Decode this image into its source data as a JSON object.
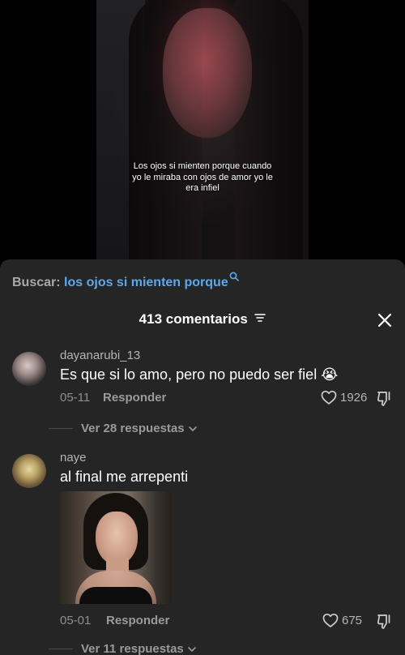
{
  "video": {
    "caption": "Los ojos si mienten porque cuando yo le miraba con ojos de amor yo le era infiel"
  },
  "search": {
    "label": "Buscar:",
    "query": "los ojos si mienten porque"
  },
  "header": {
    "comments_count": "413 comentarios"
  },
  "comments": [
    {
      "username": "dayanarubi_13",
      "text": "Es que si lo amo, pero no puedo ser fiel 😭",
      "date": "05-11",
      "reply_label": "Responder",
      "likes": "1926",
      "view_replies": "Ver 28 respuestas"
    },
    {
      "username": "naye",
      "text": "al final me arrepenti",
      "date": "05-01",
      "reply_label": "Responder",
      "likes": "675",
      "view_replies": "Ver 11 respuestas"
    }
  ],
  "colors": {
    "panel_bg": "#252525",
    "search_query": "#5aa9ef",
    "muted_text": "#8e8e8e"
  },
  "icons": [
    "search-icon",
    "filter-icon",
    "close-icon",
    "heart-icon",
    "dislike-icon",
    "chevron-down-icon"
  ]
}
